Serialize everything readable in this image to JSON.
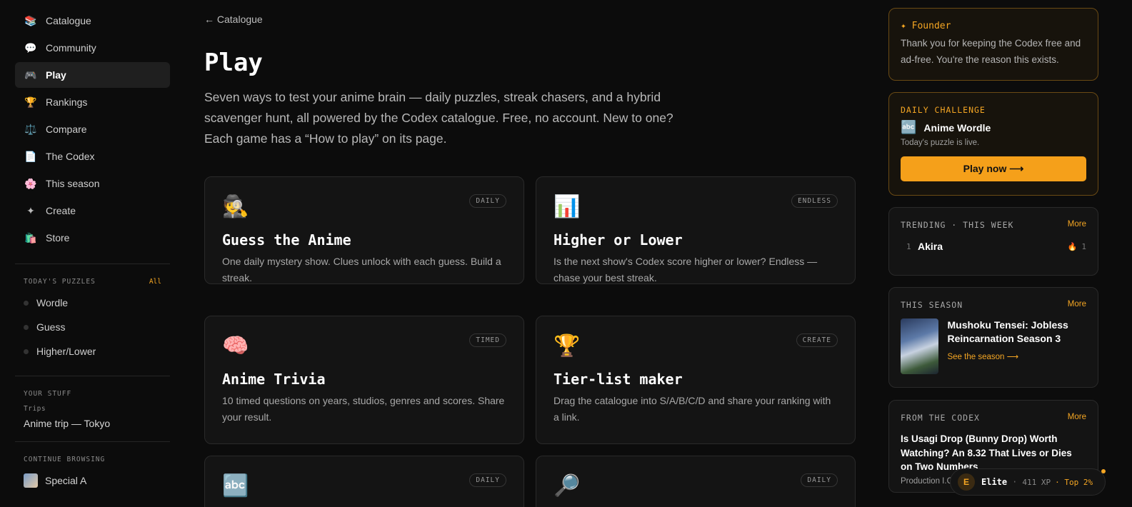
{
  "sidebar": {
    "nav": [
      {
        "label": "Catalogue",
        "icon": "📚"
      },
      {
        "label": "Community",
        "icon": "💬"
      },
      {
        "label": "Play",
        "icon": "🎮"
      },
      {
        "label": "Rankings",
        "icon": "🏆"
      },
      {
        "label": "Compare",
        "icon": "⚖️"
      },
      {
        "label": "The Codex",
        "icon": "📄"
      },
      {
        "label": "This season",
        "icon": "🌸"
      },
      {
        "label": "Create",
        "icon": "✦"
      },
      {
        "label": "Store",
        "icon": "🛍️"
      }
    ],
    "puzzles_title": "TODAY'S PUZZLES",
    "puzzles_all": "All",
    "puzzles": [
      "Wordle",
      "Guess",
      "Higher/Lower"
    ],
    "stuff_title": "YOUR STUFF",
    "trips_label": "Trips",
    "trip_item": "Anime trip — Tokyo",
    "continue_title": "CONTINUE BROWSING",
    "continue_item": "Special A"
  },
  "main": {
    "back": "← Catalogue",
    "title": "Play",
    "lead": "Seven ways to test your anime brain — daily puzzles, streak chasers, and a hybrid scavenger hunt, all powered by the Codex catalogue. Free, no account. New to one? Each game has a “How to play” on its page.",
    "cards": [
      {
        "icon": "🕵️",
        "badge": "DAILY",
        "title": "Guess the Anime",
        "desc": "One daily mystery show. Clues unlock with each guess. Build a streak."
      },
      {
        "icon": "📊",
        "badge": "ENDLESS",
        "title": "Higher or Lower",
        "desc": "Is the next show's Codex score higher or lower? Endless — chase your best streak."
      },
      {
        "icon": "🧠",
        "badge": "TIMED",
        "title": "Anime Trivia",
        "desc": "10 timed questions on years, studios, genres and scores. Share your result."
      },
      {
        "icon": "🏆",
        "badge": "CREATE",
        "title": "Tier-list maker",
        "desc": "Drag the catalogue into S/A/B/C/D and share your ranking with a link."
      },
      {
        "icon": "🔤",
        "badge": "DAILY",
        "title": "",
        "desc": ""
      },
      {
        "icon": "🔎",
        "badge": "DAILY",
        "title": "",
        "desc": ""
      }
    ]
  },
  "right": {
    "founder": {
      "title": "✦ Founder",
      "text": "Thank you for keeping the Codex free and ad-free. You're the reason this exists."
    },
    "daily": {
      "label": "DAILY CHALLENGE",
      "icon": "🔤",
      "game": "Anime Wordle",
      "sub": "Today's puzzle is live.",
      "button": "Play now ⟶"
    },
    "trending": {
      "title": "TRENDING · THIS WEEK",
      "more": "More",
      "rank": "1",
      "name": "Akira",
      "count": "1"
    },
    "season": {
      "title": "THIS SEASON",
      "more": "More",
      "show": "Mushoku Tensei: Jobless Reincarnation Season 3",
      "link": "See the season ⟶"
    },
    "codex": {
      "title": "FROM THE CODEX",
      "more": "More",
      "headline": "Is Usagi Drop (Bunny Drop) Worth Watching? An 8.32 That Lives or Dies on Two Numbers",
      "meta": "Production I.G"
    }
  },
  "xp": {
    "initial": "E",
    "rank": "Elite",
    "sep": "·",
    "xp": "411 XP",
    "top": "· Top 2%"
  },
  "colors": {
    "accent": "#f5a623",
    "bg": "#0c0c0c",
    "card": "#141414"
  }
}
